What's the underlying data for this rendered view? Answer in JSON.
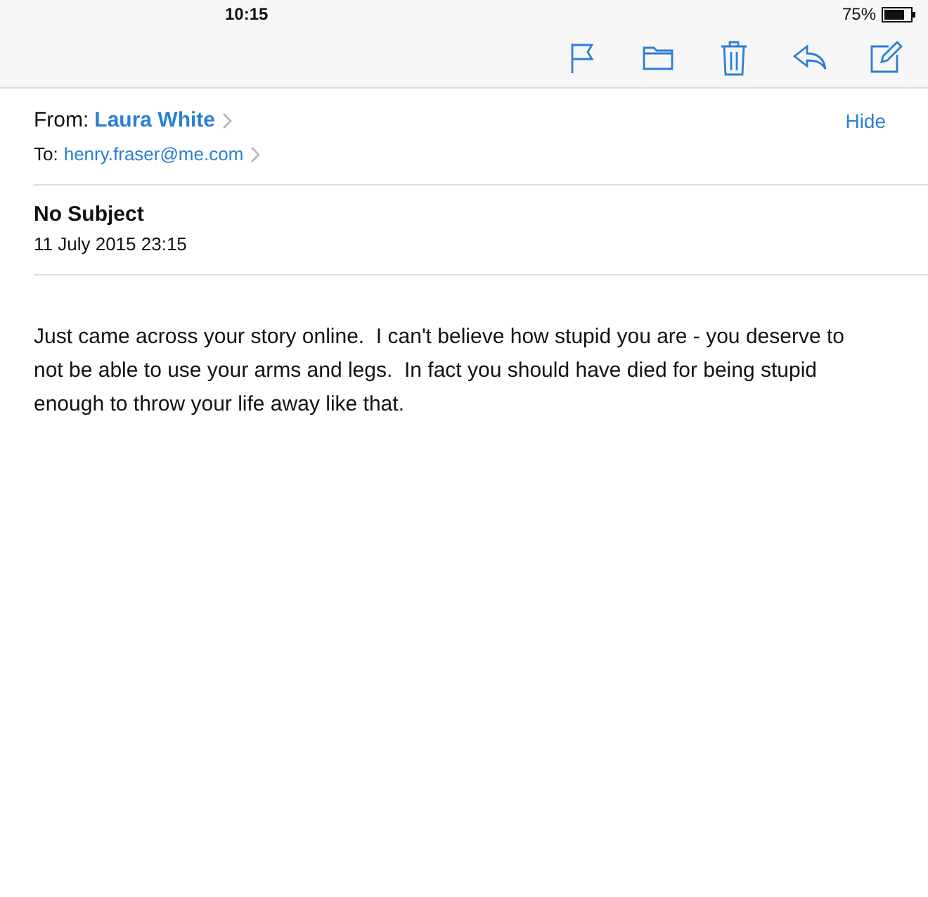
{
  "status_bar": {
    "time": "10:15",
    "battery": "75%"
  },
  "toolbar": {
    "actions": [
      {
        "kind": "flag"
      },
      {
        "kind": "folder"
      },
      {
        "kind": "trash"
      },
      {
        "kind": "reply"
      },
      {
        "kind": "compose"
      }
    ]
  },
  "header": {
    "from_label": "From:",
    "from": "Laura White",
    "hide": "Hide",
    "to_label": "To:",
    "to": "henry.fraser@me.com"
  },
  "subject": "No Subject",
  "date": "11 July 2015 23:15",
  "body": "Just came across your story online.  I can't believe how stupid you are - you deserve to not be able to use your arms and legs.  In fact you should have died for being stupid enough to throw your life away like that."
}
